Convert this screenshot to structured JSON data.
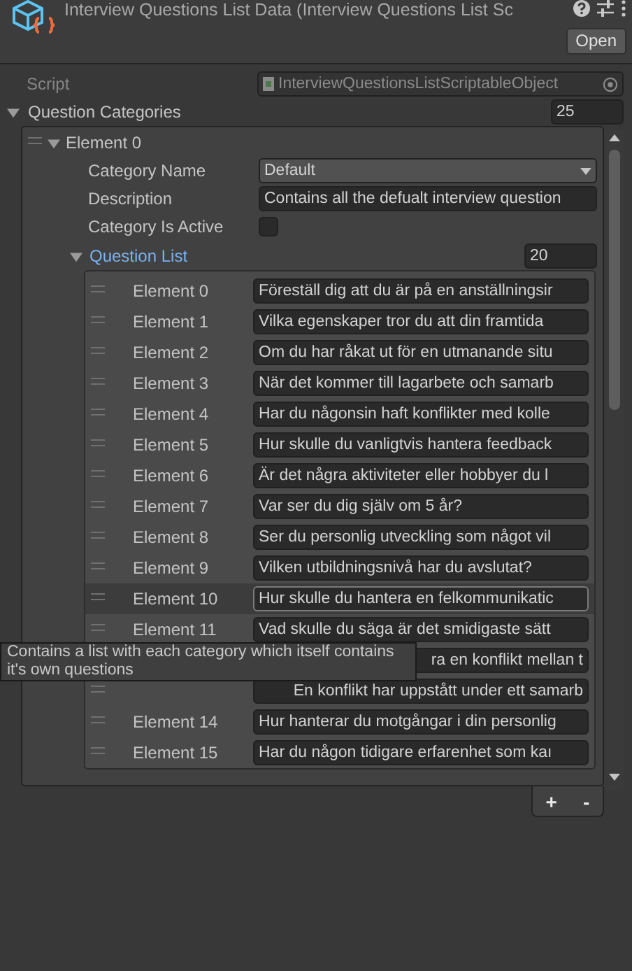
{
  "header": {
    "title": "Interview Questions List Data (Interview Questions List Sc",
    "open_button": "Open"
  },
  "script_field": {
    "label": "Script",
    "value": "InterviewQuestionsListScriptableObject"
  },
  "question_categories": {
    "label": "Question Categories",
    "expanded": true,
    "count": "25",
    "element": {
      "label": "Element 0",
      "expanded": true,
      "category_name": {
        "label": "Category Name",
        "value": "Default"
      },
      "description": {
        "label": "Description",
        "value": "Contains all the defualt interview question"
      },
      "category_is_active": {
        "label": "Category Is Active",
        "checked": false
      },
      "question_list": {
        "label": "Question List",
        "expanded": true,
        "count": "20",
        "items": [
          {
            "label": "Element 0",
            "value": "Föreställ dig att du är på en anställningsir",
            "selected": false
          },
          {
            "label": "Element 1",
            "value": "Vilka egenskaper tror du att din framtida",
            "selected": false
          },
          {
            "label": "Element 2",
            "value": "Om du har råkat ut för en utmanande situ",
            "selected": false
          },
          {
            "label": "Element 3",
            "value": "När det kommer till lagarbete och samarb",
            "selected": false
          },
          {
            "label": "Element 4",
            "value": "Har du någonsin haft konflikter med kolle",
            "selected": false
          },
          {
            "label": "Element 5",
            "value": "Hur skulle du vanligtvis hantera feedback",
            "selected": false
          },
          {
            "label": "Element 6",
            "value": "Är det några aktiviteter eller hobbyer du l",
            "selected": false
          },
          {
            "label": "Element 7",
            "value": "Var ser du dig själv om 5 år?",
            "selected": false
          },
          {
            "label": "Element 8",
            "value": "Ser du personlig utveckling som något vil",
            "selected": false
          },
          {
            "label": "Element 9",
            "value": "Vilken utbildningsnivå har du avslutat?",
            "selected": false
          },
          {
            "label": "Element 10",
            "value": "Hur skulle du hantera en felkommunikatic",
            "selected": true
          },
          {
            "label": "Element 11",
            "value": "Vad skulle du säga är det smidigaste sätt",
            "selected": false
          },
          {
            "kind": "covered",
            "value": "ra en konflikt mellan t",
            "selected": false
          },
          {
            "kind": "covered",
            "value": "En konflikt har uppstått under ett samarb",
            "selected": false
          },
          {
            "label": "Element 14",
            "value": "Hur hanterar du motgångar i din personlig",
            "selected": false
          },
          {
            "label": "Element 15",
            "value": "Har du någon tidigare erfarenhet som kaı",
            "selected": false
          }
        ]
      }
    }
  },
  "list_buttons": [
    "+",
    "-"
  ],
  "tooltip": "Contains a list with each category which itself contains it's own questions"
}
